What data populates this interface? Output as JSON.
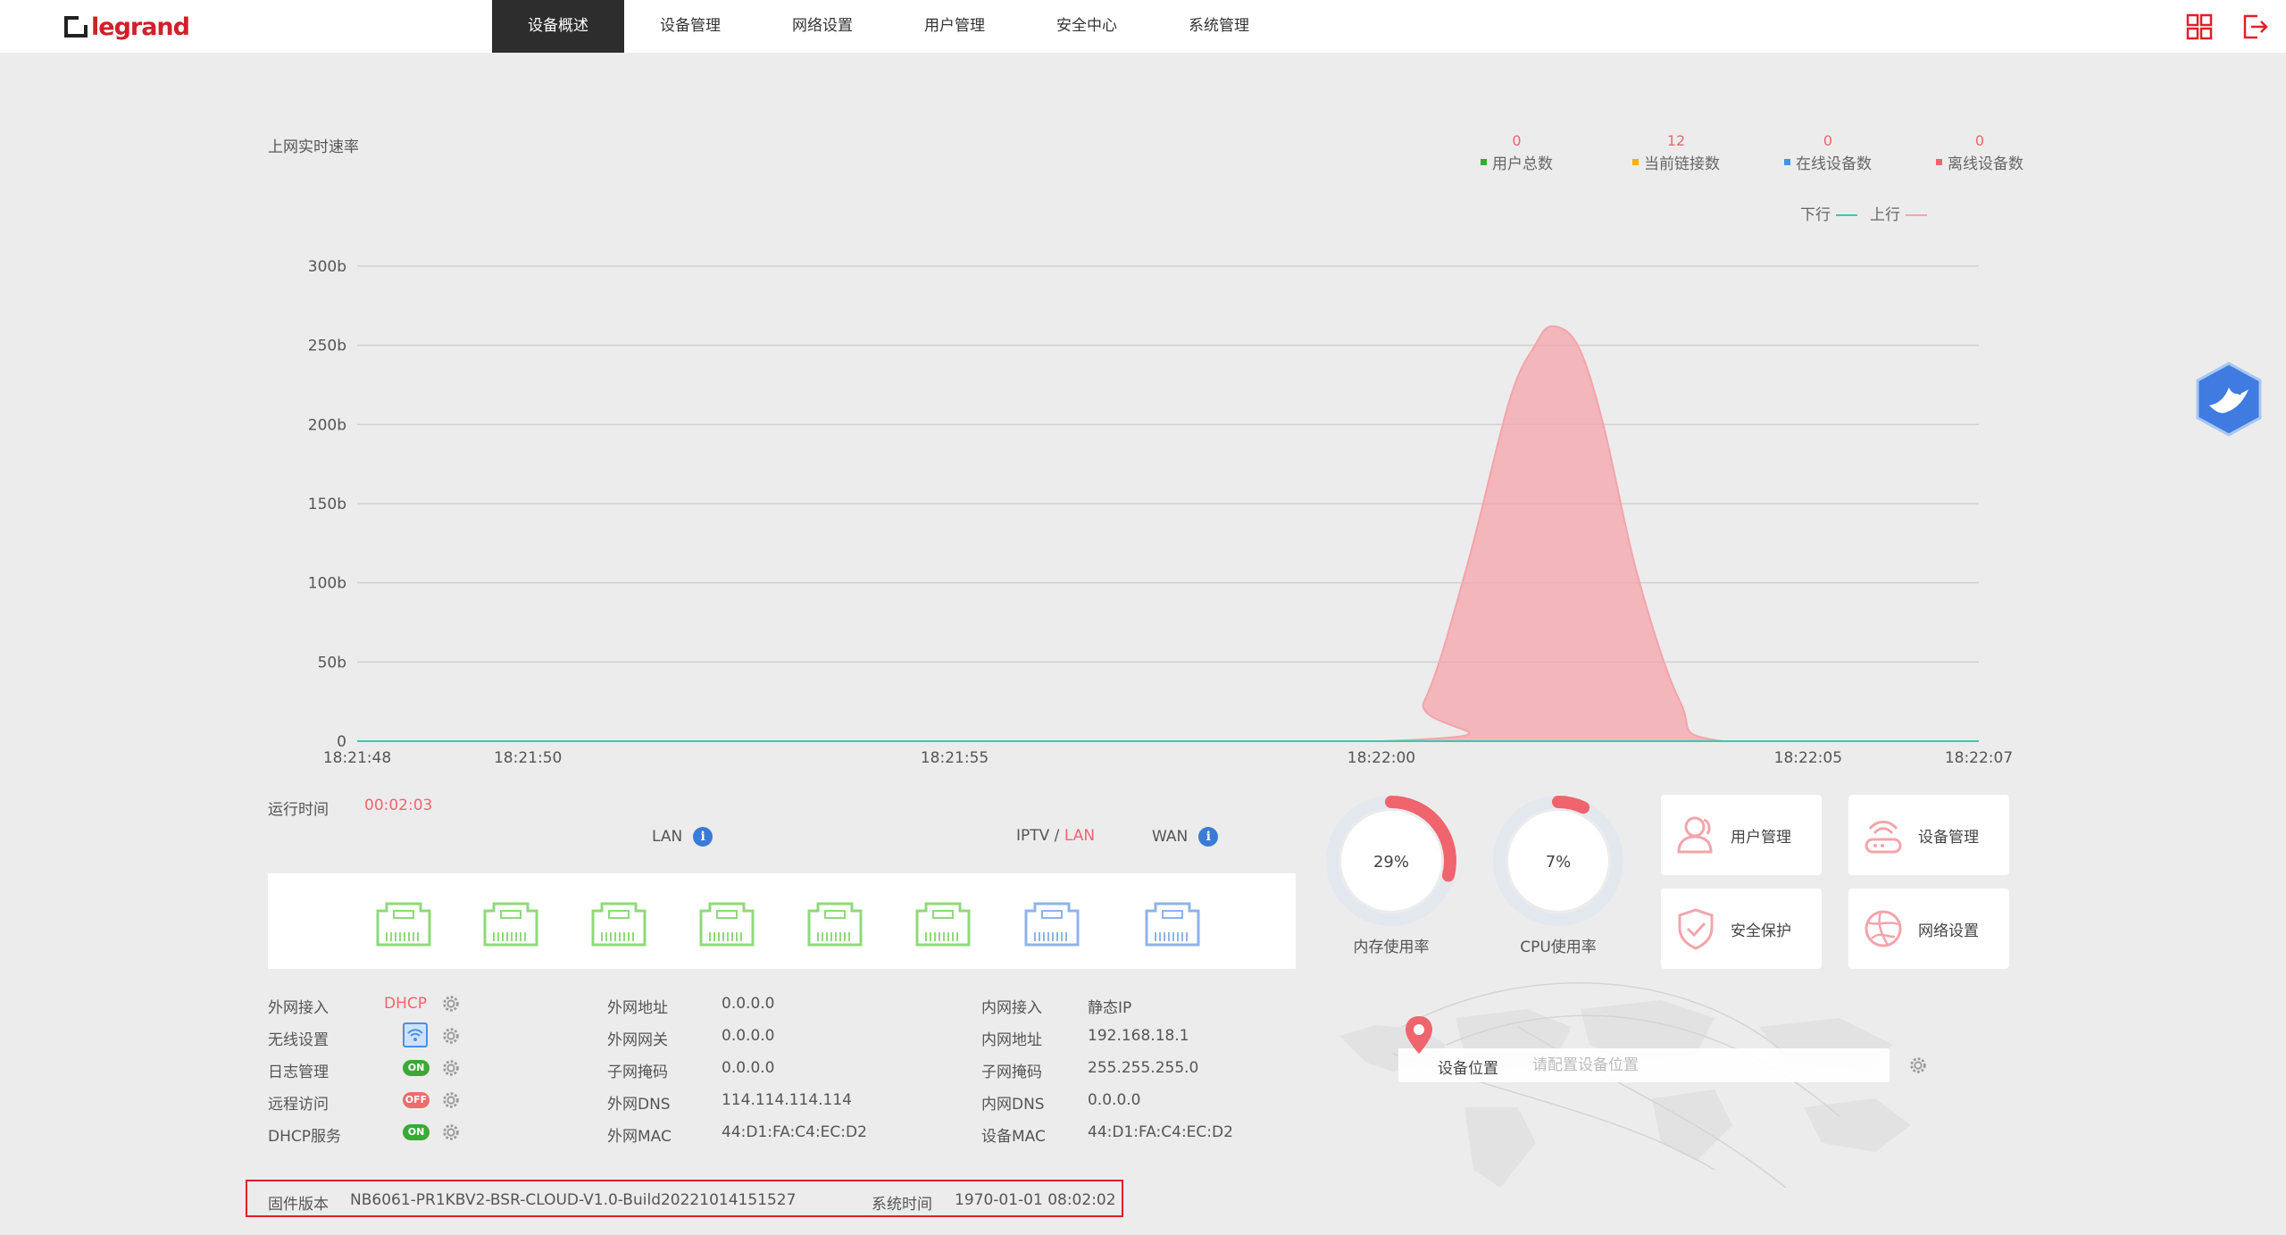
{
  "brand": {
    "logo_text": "legrand",
    "accent": "#d0202a"
  },
  "nav": {
    "items": [
      {
        "label": "设备概述"
      },
      {
        "label": "设备管理"
      },
      {
        "label": "网络设置"
      },
      {
        "label": "用户管理"
      },
      {
        "label": "安全中心"
      },
      {
        "label": "系统管理"
      }
    ],
    "active_index": 0
  },
  "header_icons": {
    "grid": "grid-icon",
    "logout": "logout-icon"
  },
  "speed_title": "上网实时速率",
  "stats": [
    {
      "value": "0",
      "label": "用户总数",
      "color": "#3aaa35"
    },
    {
      "value": "12",
      "label": "当前链接数",
      "color": "#f5b400"
    },
    {
      "value": "0",
      "label": "在线设备数",
      "color": "#4a90e2"
    },
    {
      "value": "0",
      "label": "离线设备数",
      "color": "#f0646e"
    }
  ],
  "legend": {
    "down": "下行",
    "up": "上行",
    "down_color": "#3cc7b4",
    "up_color": "#f4a4ab"
  },
  "chart_data": {
    "type": "area",
    "title": "上网实时速率",
    "x_ticks": [
      "18:21:48",
      "18:21:50",
      "18:21:55",
      "18:22:00",
      "18:22:05",
      "18:22:07"
    ],
    "x_tick_seconds": [
      0,
      2,
      7,
      12,
      17,
      19
    ],
    "y_ticks": [
      "0",
      "50b",
      "100b",
      "150b",
      "200b",
      "250b",
      "300b"
    ],
    "ylim": [
      0,
      300
    ],
    "xlim": [
      0,
      19
    ],
    "grid": true,
    "series": [
      {
        "name": "上行",
        "color": "#f4a4ab",
        "x": [
          0,
          12,
          12.5,
          13,
          13.5,
          13.8,
          14,
          14.3,
          14.6,
          15,
          15.5,
          16,
          19
        ],
        "values": [
          0,
          0,
          25,
          110,
          215,
          250,
          262,
          250,
          200,
          105,
          25,
          0,
          0
        ]
      },
      {
        "name": "下行",
        "color": "#3cc7b4",
        "x": [
          0,
          19
        ],
        "values": [
          0,
          0
        ]
      }
    ]
  },
  "uptime": {
    "label": "运行时间",
    "value": "00:02:03"
  },
  "ports": {
    "lan_label": "LAN",
    "iptv_label": "IPTV / ",
    "iptv_lan_label": "LAN",
    "wan_label": "WAN",
    "list": [
      {
        "type": "lan",
        "color": "#8fd97a"
      },
      {
        "type": "lan",
        "color": "#8fd97a"
      },
      {
        "type": "lan",
        "color": "#8fd97a"
      },
      {
        "type": "lan",
        "color": "#8fd97a"
      },
      {
        "type": "lan",
        "color": "#8fd97a"
      },
      {
        "type": "lan",
        "color": "#8fd97a"
      },
      {
        "type": "iptv",
        "color": "#8fb3e8"
      },
      {
        "type": "wan",
        "color": "#8fb3e8"
      }
    ]
  },
  "gauges": [
    {
      "percent": 29,
      "text": "29%",
      "label": "内存使用率"
    },
    {
      "percent": 7,
      "text": "7%",
      "label": "CPU使用率"
    }
  ],
  "tiles": [
    {
      "label": "用户管理",
      "icon": "user-icon"
    },
    {
      "label": "设备管理",
      "icon": "router-icon"
    },
    {
      "label": "安全保护",
      "icon": "shield-icon"
    },
    {
      "label": "网络设置",
      "icon": "globe-icon"
    }
  ],
  "settings": {
    "wan_access": {
      "label": "外网接入",
      "value": "DHCP"
    },
    "wireless": {
      "label": "无线设置"
    },
    "log": {
      "label": "日志管理",
      "state": "ON"
    },
    "remote": {
      "label": "远程访问",
      "state": "OFF"
    },
    "dhcp": {
      "label": "DHCP服务",
      "state": "ON"
    }
  },
  "wan_info": [
    {
      "label": "外网地址",
      "value": "0.0.0.0"
    },
    {
      "label": "外网网关",
      "value": "0.0.0.0"
    },
    {
      "label": "子网掩码",
      "value": "0.0.0.0"
    },
    {
      "label": "外网DNS",
      "value": "114.114.114.114"
    },
    {
      "label": "外网MAC",
      "value": "44:D1:FA:C4:EC:D2"
    }
  ],
  "lan_info": [
    {
      "label": "内网接入",
      "value": "静态IP"
    },
    {
      "label": "内网地址",
      "value": "192.168.18.1"
    },
    {
      "label": "子网掩码",
      "value": "255.255.255.0"
    },
    {
      "label": "内网DNS",
      "value": "0.0.0.0"
    },
    {
      "label": "设备MAC",
      "value": "44:D1:FA:C4:EC:D2"
    }
  ],
  "location": {
    "label": "设备位置",
    "placeholder": "请配置设备位置"
  },
  "footer": {
    "fw_label": "固件版本",
    "fw_value": "NB6061-PR1KBV2-BSR-CLOUD-V1.0-Build20221014151527",
    "time_label": "系统时间",
    "time_value": "1970-01-01 08:02:02"
  }
}
